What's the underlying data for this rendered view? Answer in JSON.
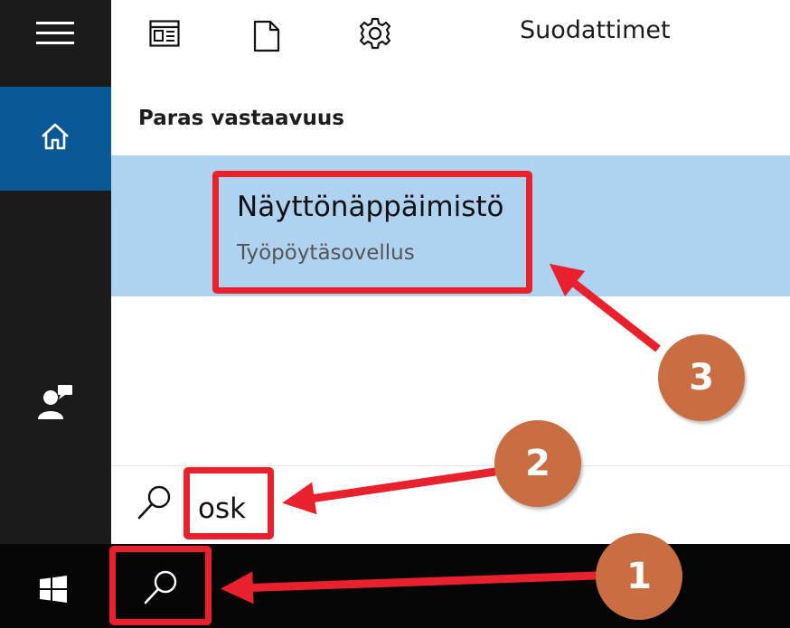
{
  "topbar": {
    "filters_label": "Suodattimet",
    "icons": [
      "news-icon",
      "document-icon",
      "gear-icon"
    ]
  },
  "sidebar": {
    "icons": [
      "hamburger-menu-icon",
      "home-icon",
      "feedback-icon"
    ]
  },
  "results": {
    "section_title": "Paras vastaavuus",
    "best_match": {
      "name": "Näyttönäppäimistö",
      "type": "Työpöytäsovellus"
    }
  },
  "search": {
    "query": "osk",
    "icon": "search-icon"
  },
  "taskbar": {
    "icons": [
      "windows-logo-icon",
      "search-icon"
    ]
  },
  "annotations": {
    "badges": [
      "1",
      "2",
      "3"
    ],
    "badge_color": "#c86e42",
    "highlight_color": "#e8212d",
    "accent_color": "#0b5896",
    "selection_color": "#aed2ef"
  }
}
